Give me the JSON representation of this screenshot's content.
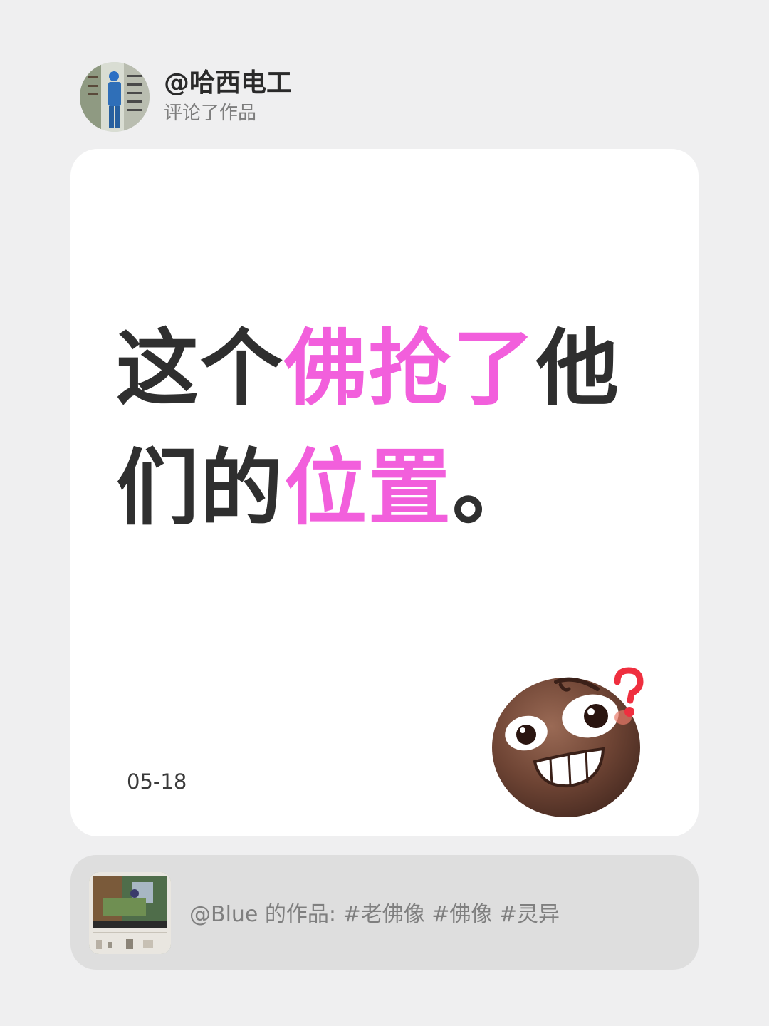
{
  "header": {
    "username": "@哈西电工",
    "action": "评论了作品"
  },
  "comment": {
    "segments": [
      {
        "text": "这个",
        "highlight": false
      },
      {
        "text": "佛抢了",
        "highlight": true
      },
      {
        "text": "他们的",
        "highlight": false
      },
      {
        "text": "位置",
        "highlight": true
      },
      {
        "text": "。",
        "highlight": false
      }
    ],
    "highlight_color": "#f25fdc",
    "text_color": "#2f2f2f"
  },
  "date": "05-18",
  "emoji": {
    "icon": "nervous-grin-question-emoji"
  },
  "source": {
    "text": "@Blue 的作品: #老佛像 #佛像 #灵异",
    "thumbnail_icon": "video-thumbnail"
  },
  "colors": {
    "background": "#efeff0",
    "card": "#ffffff",
    "source_bar": "#dedede"
  }
}
